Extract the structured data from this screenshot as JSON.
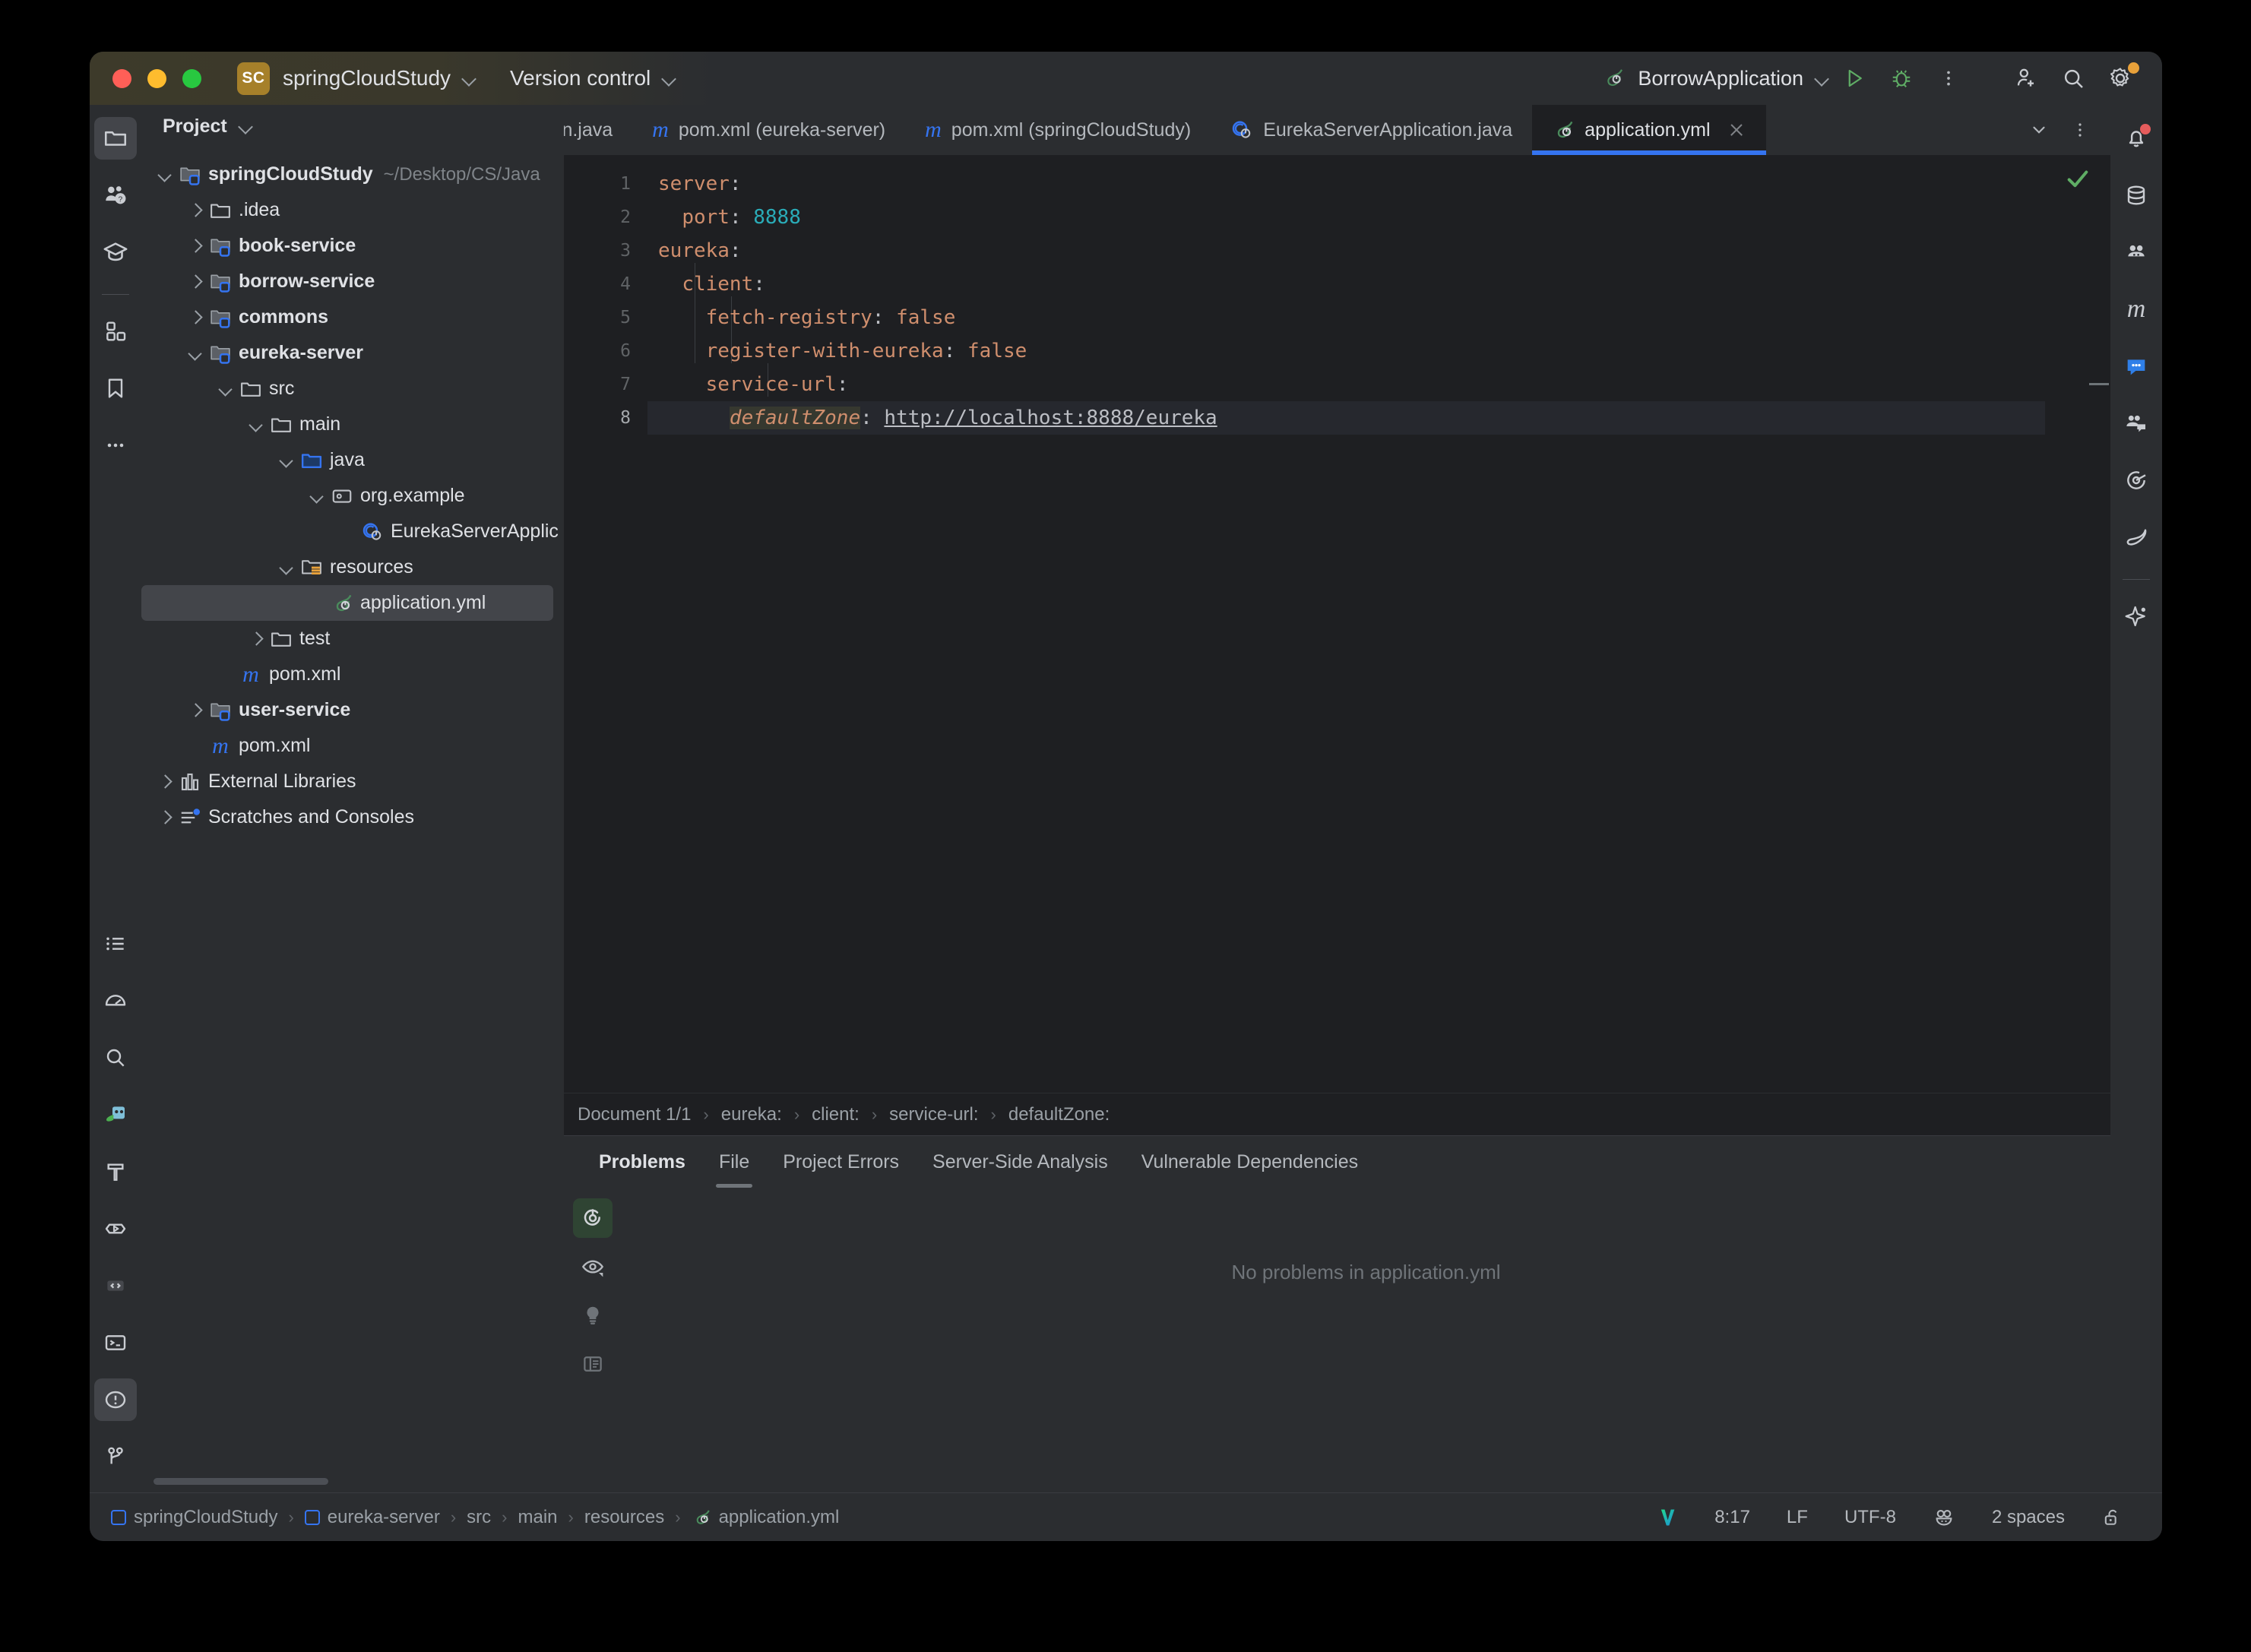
{
  "titlebar": {
    "project_badge": "SC",
    "project_name": "springCloudStudy",
    "vcs_label": "Version control",
    "run_config": "BorrowApplication",
    "icons": {
      "run": "run-icon",
      "debug": "debug-icon",
      "more": "more-options-icon",
      "add_user": "add-user-icon",
      "search": "search-icon",
      "settings": "settings-icon"
    }
  },
  "left_toolstrip": [
    {
      "name": "project-tool-window",
      "icon": "folder-icon",
      "active": true
    },
    {
      "name": "ai-assistant-tool-window",
      "icon": "people-question-icon",
      "active": false
    },
    {
      "name": "learn-tool-window",
      "icon": "graduation-cap-icon",
      "active": false
    },
    {
      "name": "structure-tool-window",
      "icon": "structure-blocks-icon",
      "active": false
    },
    {
      "name": "bookmarks-tool-window",
      "icon": "bookmark-icon",
      "active": false
    },
    {
      "name": "more-tool-windows",
      "icon": "ellipsis-icon",
      "active": false
    }
  ],
  "left_toolstrip_bottom": [
    {
      "name": "todo-tool-window",
      "icon": "list-icon",
      "active": false
    },
    {
      "name": "profiler-tool-window",
      "icon": "gauge-icon",
      "active": false
    },
    {
      "name": "find-tool-window",
      "icon": "magnifier-icon",
      "active": false
    },
    {
      "name": "spring-tool-window",
      "icon": "spring-boot-icon",
      "active": false
    },
    {
      "name": "build-tool-window",
      "icon": "hammer-icon",
      "active": false
    },
    {
      "name": "run-tool-window",
      "icon": "play-hexagon-icon",
      "active": false
    },
    {
      "name": "debug-tool-window",
      "icon": "brackets-icon",
      "active": false
    },
    {
      "name": "terminal-tool-window",
      "icon": "terminal-icon",
      "active": false
    },
    {
      "name": "problems-tool-window",
      "icon": "warning-circle-icon",
      "active": true
    },
    {
      "name": "version-control-tool-window",
      "icon": "branch-icon",
      "active": false
    }
  ],
  "right_toolstrip": [
    {
      "name": "notifications-tool-window",
      "icon": "bell-icon",
      "badge": true
    },
    {
      "name": "database-tool-window",
      "icon": "database-icon",
      "badge": false
    },
    {
      "name": "kubernetes-tool-window",
      "icon": "kubernetes-icon",
      "badge": false
    },
    {
      "name": "maven-tool-window",
      "icon": "maven-m-icon",
      "badge": false
    },
    {
      "name": "ai-chat-tool-window",
      "icon": "chat-bubble-icon",
      "badge": false
    },
    {
      "name": "code-with-me-tool-window",
      "icon": "people-chat-icon",
      "badge": false
    },
    {
      "name": "endpoints-tool-window",
      "icon": "target-icon",
      "badge": false
    },
    {
      "name": "mongodb-tool-window",
      "icon": "leaf-icon",
      "badge": false
    },
    {
      "name": "ai-sparkle-tool-window",
      "icon": "sparkle-icon",
      "badge": false
    }
  ],
  "project_panel": {
    "title": "Project",
    "tree": [
      {
        "depth": 0,
        "arrow": "down",
        "icon": "module-folder-icon",
        "label": "springCloudStudy",
        "bold": true,
        "path": "~/Desktop/CS/Java",
        "selected": false
      },
      {
        "depth": 1,
        "arrow": "right",
        "icon": "folder-icon",
        "label": ".idea",
        "bold": false,
        "path": "",
        "selected": false
      },
      {
        "depth": 1,
        "arrow": "right",
        "icon": "module-folder-icon",
        "label": "book-service",
        "bold": true,
        "path": "",
        "selected": false
      },
      {
        "depth": 1,
        "arrow": "right",
        "icon": "module-folder-icon",
        "label": "borrow-service",
        "bold": true,
        "path": "",
        "selected": false
      },
      {
        "depth": 1,
        "arrow": "right",
        "icon": "module-folder-icon",
        "label": "commons",
        "bold": true,
        "path": "",
        "selected": false
      },
      {
        "depth": 1,
        "arrow": "down",
        "icon": "module-folder-icon",
        "label": "eureka-server",
        "bold": true,
        "path": "",
        "selected": false
      },
      {
        "depth": 2,
        "arrow": "down",
        "icon": "folder-icon",
        "label": "src",
        "bold": false,
        "path": "",
        "selected": false
      },
      {
        "depth": 3,
        "arrow": "down",
        "icon": "folder-icon",
        "label": "main",
        "bold": false,
        "path": "",
        "selected": false
      },
      {
        "depth": 4,
        "arrow": "down",
        "icon": "sources-folder-icon",
        "label": "java",
        "bold": false,
        "path": "",
        "selected": false
      },
      {
        "depth": 5,
        "arrow": "down",
        "icon": "package-icon",
        "label": "org.example",
        "bold": false,
        "path": "",
        "selected": false
      },
      {
        "depth": 6,
        "arrow": "none",
        "icon": "spring-class-icon",
        "label": "EurekaServerApplic",
        "bold": false,
        "path": "",
        "selected": false
      },
      {
        "depth": 4,
        "arrow": "down",
        "icon": "resources-folder-icon",
        "label": "resources",
        "bold": false,
        "path": "",
        "selected": false
      },
      {
        "depth": 5,
        "arrow": "none",
        "icon": "spring-yml-icon",
        "label": "application.yml",
        "bold": false,
        "path": "",
        "selected": true
      },
      {
        "depth": 3,
        "arrow": "right",
        "icon": "folder-icon",
        "label": "test",
        "bold": false,
        "path": "",
        "selected": false
      },
      {
        "depth": 2,
        "arrow": "none",
        "icon": "maven-m-icon",
        "label": "pom.xml",
        "bold": false,
        "path": "",
        "selected": false
      },
      {
        "depth": 1,
        "arrow": "right",
        "icon": "module-folder-icon",
        "label": "user-service",
        "bold": true,
        "path": "",
        "selected": false
      },
      {
        "depth": 1,
        "arrow": "none",
        "icon": "maven-m-icon",
        "label": "pom.xml",
        "bold": false,
        "path": "",
        "selected": false
      },
      {
        "depth": 0,
        "arrow": "right",
        "icon": "libraries-icon",
        "label": "External Libraries",
        "bold": false,
        "path": "",
        "selected": false
      },
      {
        "depth": 0,
        "arrow": "right",
        "icon": "scratches-icon",
        "label": "Scratches and Consoles",
        "bold": false,
        "path": "",
        "selected": false
      }
    ]
  },
  "editor_tabs": [
    {
      "label": "ion.java",
      "icon": "java-class-icon",
      "active": false,
      "clipped": true
    },
    {
      "label": "pom.xml (eureka-server)",
      "icon": "maven-m-icon",
      "active": false,
      "clipped": false
    },
    {
      "label": "pom.xml (springCloudStudy)",
      "icon": "maven-m-icon",
      "active": false,
      "clipped": false
    },
    {
      "label": "EurekaServerApplication.java",
      "icon": "spring-class-icon",
      "active": false,
      "clipped": false
    },
    {
      "label": "application.yml",
      "icon": "spring-yml-icon",
      "active": true,
      "clipped": false
    }
  ],
  "editor": {
    "filename": "application.yml",
    "language": "yaml",
    "line_numbers": [
      "1",
      "2",
      "3",
      "4",
      "5",
      "6",
      "7",
      "8"
    ],
    "current_line": 8,
    "lines": [
      {
        "n": 1,
        "tokens": [
          {
            "t": "server",
            "c": "k"
          },
          {
            "t": ":",
            "c": "punct"
          }
        ]
      },
      {
        "n": 2,
        "tokens": [
          {
            "t": "  ",
            "c": "punct"
          },
          {
            "t": "port",
            "c": "k"
          },
          {
            "t": ": ",
            "c": "punct"
          },
          {
            "t": "8888",
            "c": "num"
          }
        ]
      },
      {
        "n": 3,
        "tokens": [
          {
            "t": "eureka",
            "c": "k"
          },
          {
            "t": ":",
            "c": "punct"
          }
        ]
      },
      {
        "n": 4,
        "tokens": [
          {
            "t": "  ",
            "c": "punct"
          },
          {
            "t": "client",
            "c": "k"
          },
          {
            "t": ":",
            "c": "punct"
          }
        ]
      },
      {
        "n": 5,
        "tokens": [
          {
            "t": "    ",
            "c": "punct"
          },
          {
            "t": "fetch-registry",
            "c": "k"
          },
          {
            "t": ": ",
            "c": "punct"
          },
          {
            "t": "false",
            "c": "val"
          }
        ]
      },
      {
        "n": 6,
        "tokens": [
          {
            "t": "    ",
            "c": "punct"
          },
          {
            "t": "register-with-eureka",
            "c": "k"
          },
          {
            "t": ": ",
            "c": "punct"
          },
          {
            "t": "false",
            "c": "val"
          }
        ]
      },
      {
        "n": 7,
        "tokens": [
          {
            "t": "    ",
            "c": "punct"
          },
          {
            "t": "service-url",
            "c": "k"
          },
          {
            "t": ":",
            "c": "punct"
          }
        ]
      },
      {
        "n": 8,
        "tokens": [
          {
            "t": "      ",
            "c": "punct"
          },
          {
            "t": "defaultZone",
            "c": "key-italic"
          },
          {
            "t": ": ",
            "c": "punct"
          },
          {
            "t": "http://localhost:8888/eureka",
            "c": "url"
          }
        ]
      }
    ],
    "raw_text": "server:\n  port: 8888\neureka:\n  client:\n    fetch-registry: false\n    register-with-eureka: false\n    service-url:\n      defaultZone: http://localhost:8888/eureka",
    "inspection_status": "ok-check-icon"
  },
  "breadcrumb": {
    "items": [
      "Document 1/1",
      "eureka:",
      "client:",
      "service-url:",
      "defaultZone:"
    ]
  },
  "problems_panel": {
    "tabs": [
      {
        "label": "Problems",
        "bold": true,
        "selected": false
      },
      {
        "label": "File",
        "bold": false,
        "selected": true
      },
      {
        "label": "Project Errors",
        "bold": false,
        "selected": false
      },
      {
        "label": "Server-Side Analysis",
        "bold": false,
        "selected": false
      },
      {
        "label": "Vulnerable Dependencies",
        "bold": false,
        "selected": false
      }
    ],
    "toolbar": [
      {
        "name": "inspections-power-toggle",
        "icon": "power-highlight-icon",
        "active": true
      },
      {
        "name": "inspection-visibility",
        "icon": "eye-icon",
        "active": false
      },
      {
        "name": "show-quick-fixes",
        "icon": "lightbulb-icon",
        "active": false
      },
      {
        "name": "toggle-preview-panel",
        "icon": "preview-panel-icon",
        "active": false
      }
    ],
    "empty_message": "No problems in application.yml"
  },
  "statusbar": {
    "path": [
      "springCloudStudy",
      "eureka-server",
      "src",
      "main",
      "resources",
      "application.yml"
    ],
    "right": {
      "vcs_icon": "idea-v-icon",
      "caret": "8:17",
      "line_separator": "LF",
      "encoding": "UTF-8",
      "inspector_icon": "inspector-face-icon",
      "indent": "2 spaces",
      "lock_icon": "unlocked-icon"
    }
  },
  "colors": {
    "window_bg": "#1e1f22",
    "panel_bg": "#2b2d30",
    "accent_blue": "#3574f0",
    "text_primary": "#dfe1e5",
    "text_secondary": "#9aa0a6",
    "yaml_key": "#cf8e6d",
    "yaml_number": "#2aacb8",
    "selection": "#43454a"
  }
}
